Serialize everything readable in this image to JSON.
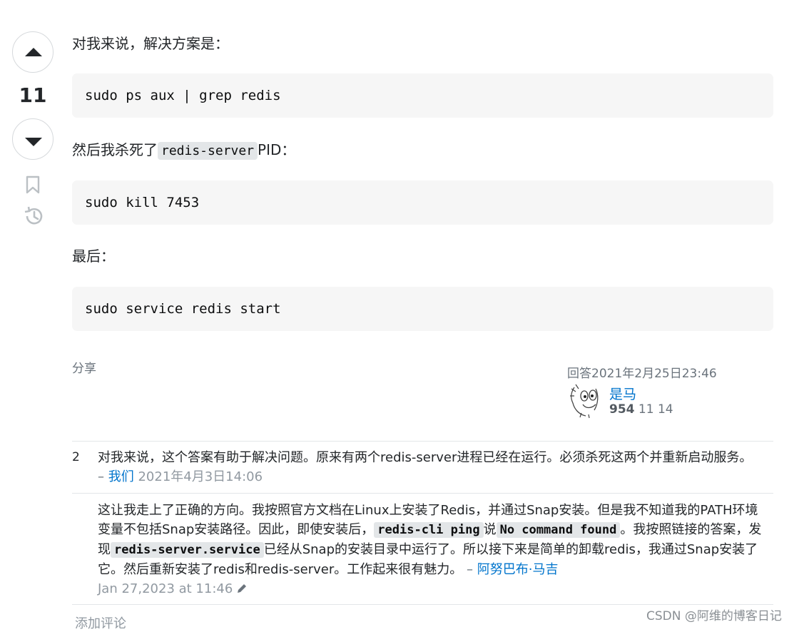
{
  "vote": {
    "count": "11"
  },
  "answer": {
    "intro": "对我来说，解决方案是：",
    "code1": "sudo ps aux | grep redis",
    "kill_pre": "然后我杀死了",
    "kill_code": "redis-server",
    "kill_post": "PID：",
    "code2": "sudo kill 7453",
    "finally": "最后：",
    "code3": "sudo service redis start"
  },
  "footer": {
    "share": "分享",
    "answered": "回答2021年2月25日23:46",
    "user_name": "是马",
    "user_rep": "954",
    "user_silver": "11",
    "user_bronze": "14"
  },
  "comments": [
    {
      "score": "2",
      "text": "对我来说，这个答案有助于解决问题。原来有两个redis-server进程已经在运行。必须杀死这两个并重新启动服务。",
      "sep": "–",
      "author": "我们",
      "date": "2021年4月3日14:06"
    },
    {
      "text_a": "这让我走上了正确的方向。我按照官方文档在Linux上安装了Redis，并通过Snap安装。但是我不知道我的PATH环境变量不包括Snap安装路径。因此，即使安装后，",
      "code_a": "redis-cli ping",
      "text_b": "说",
      "code_b": "No command found",
      "text_c": "。我按照链接的答案，发现",
      "code_c": "redis-server.service",
      "text_d": "已经从Snap的安装目录中运行了。所以接下来是简单的卸载redis，我通过Snap安装了它。然后重新安装了redis和redis-server。工作起来很有魅力。",
      "sep": "–",
      "author": "阿努巴布·马吉",
      "date": "Jan 27,2023 at 11:46"
    }
  ],
  "add_comment": "添加评论",
  "watermark": "CSDN @阿维的博客日记",
  "colors": {
    "link": "#0074cc",
    "code_bg": "#f6f6f6",
    "muted": "#6a737c"
  },
  "icons": [
    "upvote-arrow-icon",
    "downvote-arrow-icon",
    "bookmark-icon",
    "history-icon",
    "pencil-icon"
  ]
}
